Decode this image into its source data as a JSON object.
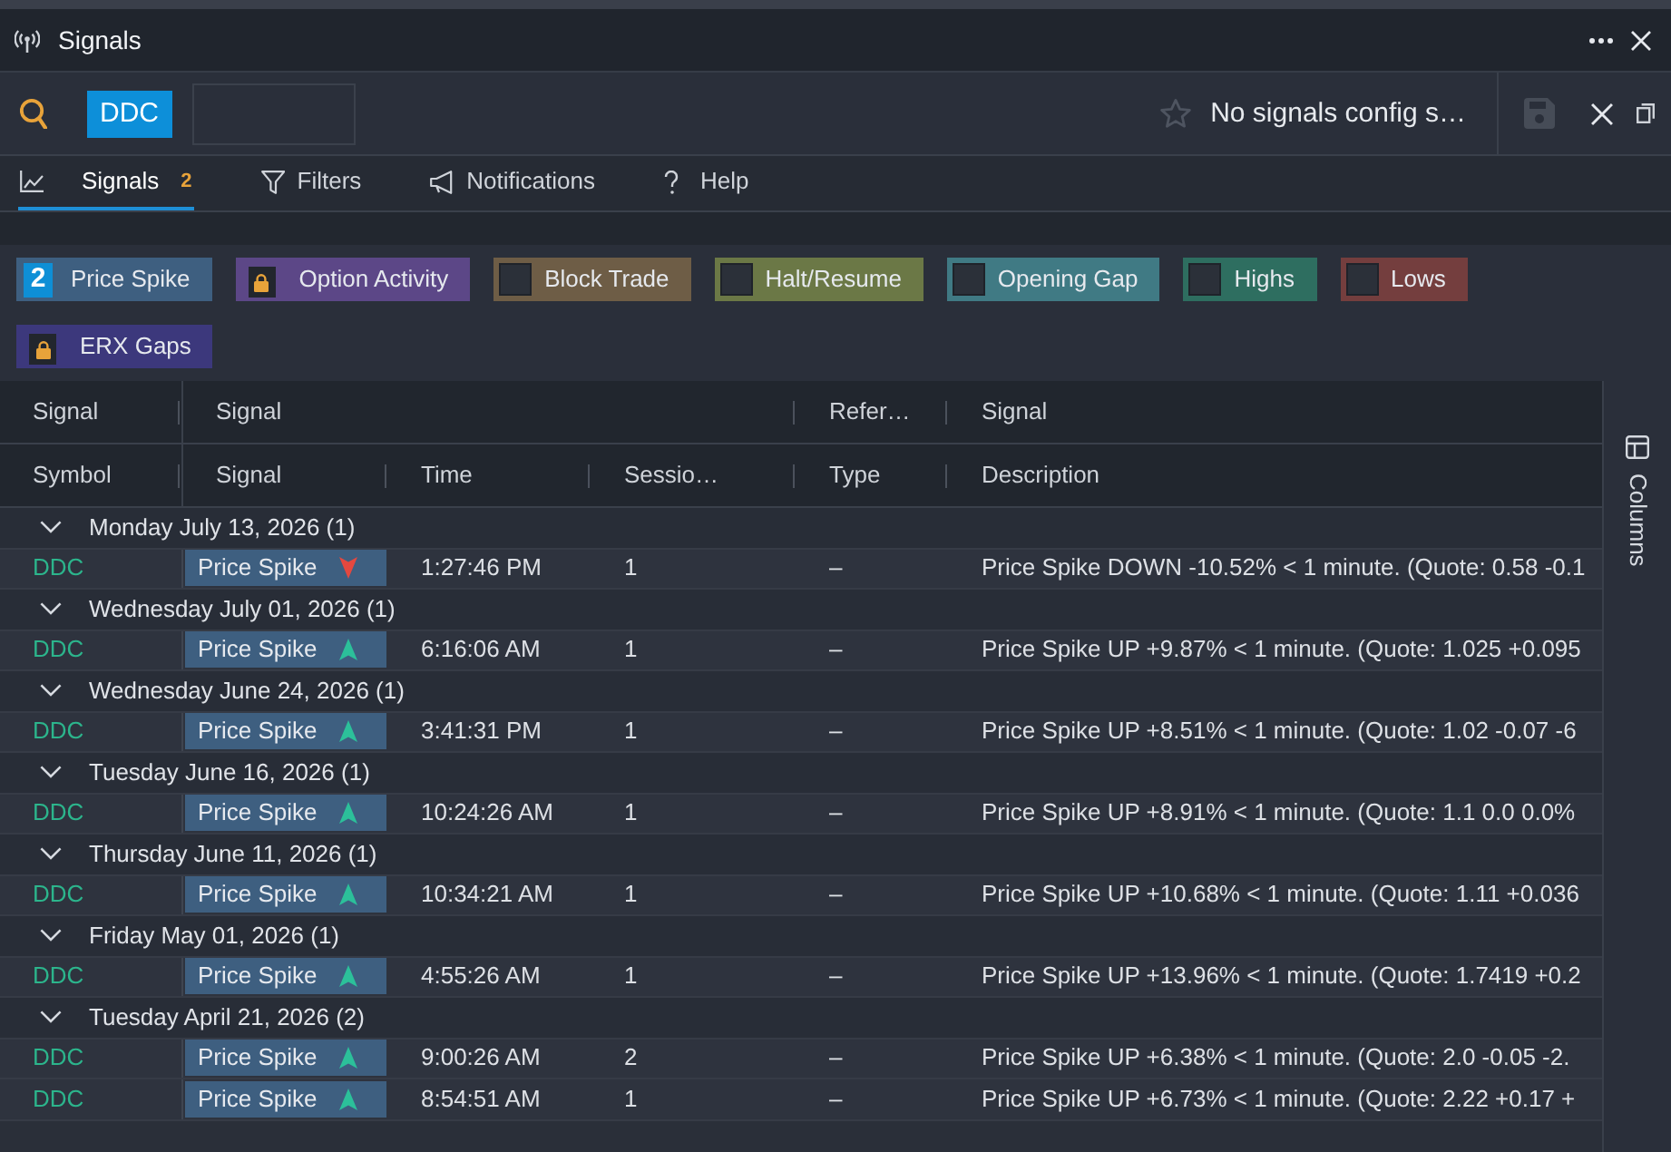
{
  "window": {
    "title": "Signals"
  },
  "toolbar": {
    "symbol": "DDC",
    "starred": false,
    "config_status": "No signals config s…",
    "save_disabled": true
  },
  "tabs": [
    {
      "label": "Signals",
      "badge": "2",
      "selected": true
    },
    {
      "label": "Filters",
      "selected": false
    },
    {
      "label": "Notifications",
      "selected": false
    },
    {
      "label": "Help",
      "selected": false
    }
  ],
  "signal_types": [
    {
      "label": "Price Spike",
      "color": "#3e5f80",
      "locked": false,
      "checked": true,
      "count": "2"
    },
    {
      "label": "Option Activity",
      "color": "#5c4787",
      "locked": true
    },
    {
      "label": "Block Trade",
      "color": "#6e5d46",
      "locked": false,
      "checked": false
    },
    {
      "label": "Halt/Resume",
      "color": "#6b7846",
      "locked": false,
      "checked": false
    },
    {
      "label": "Opening Gap",
      "color": "#407a84",
      "locked": false,
      "checked": false
    },
    {
      "label": "Highs",
      "color": "#2e6e60",
      "locked": false,
      "checked": false
    },
    {
      "label": "Lows",
      "color": "#743e3e",
      "locked": false,
      "checked": false
    },
    {
      "label": "ERX Gaps",
      "color": "#3c387c",
      "locked": true
    }
  ],
  "table": {
    "column_groups": [
      {
        "label": "Signal",
        "columns": [
          "Symbol"
        ]
      },
      {
        "label": "Signal",
        "columns": [
          "Signal",
          "Time",
          "Sessio…"
        ]
      },
      {
        "label": "Refer…",
        "columns": [
          "Type"
        ]
      },
      {
        "label": "Signal",
        "columns": [
          "Description"
        ]
      }
    ],
    "groups": [
      {
        "label": "Monday July 13, 2026 (1)",
        "expanded": true,
        "rows": [
          {
            "symbol": "DDC",
            "signal": "Price Spike",
            "kind": "down",
            "time": "1:27:46 PM",
            "session": "1",
            "type": "–",
            "description": "Price Spike DOWN -10.52% < 1 minute. (Quote: 0.58 -0.1"
          }
        ]
      },
      {
        "label": "Wednesday July 01, 2026 (1)",
        "expanded": true,
        "rows": [
          {
            "symbol": "DDC",
            "signal": "Price Spike",
            "kind": "up",
            "time": "6:16:06 AM",
            "session": "1",
            "type": "–",
            "description": "Price Spike UP +9.87% < 1 minute. (Quote: 1.025 +0.095"
          }
        ]
      },
      {
        "label": "Wednesday June 24, 2026 (1)",
        "expanded": true,
        "rows": [
          {
            "symbol": "DDC",
            "signal": "Price Spike",
            "kind": "up",
            "time": "3:41:31 PM",
            "session": "1",
            "type": "–",
            "description": "Price Spike UP +8.51% < 1 minute. (Quote: 1.02 -0.07 -6"
          }
        ]
      },
      {
        "label": "Tuesday June 16, 2026 (1)",
        "expanded": true,
        "rows": [
          {
            "symbol": "DDC",
            "signal": "Price Spike",
            "kind": "up",
            "time": "10:24:26 AM",
            "session": "1",
            "type": "–",
            "description": "Price Spike UP +8.91% < 1 minute. (Quote: 1.1 0.0 0.0%"
          }
        ]
      },
      {
        "label": "Thursday June 11, 2026 (1)",
        "expanded": true,
        "rows": [
          {
            "symbol": "DDC",
            "signal": "Price Spike",
            "kind": "up",
            "time": "10:34:21 AM",
            "session": "1",
            "type": "–",
            "description": "Price Spike UP +10.68% < 1 minute. (Quote: 1.11 +0.036"
          }
        ]
      },
      {
        "label": "Friday May 01, 2026 (1)",
        "expanded": true,
        "rows": [
          {
            "symbol": "DDC",
            "signal": "Price Spike",
            "kind": "up",
            "time": "4:55:26 AM",
            "session": "1",
            "type": "–",
            "description": "Price Spike UP +13.96% < 1 minute. (Quote: 1.7419 +0.2"
          }
        ]
      },
      {
        "label": "Tuesday April 21, 2026 (2)",
        "expanded": true,
        "rows": [
          {
            "symbol": "DDC",
            "signal": "Price Spike",
            "kind": "up",
            "time": "9:00:26 AM",
            "session": "2",
            "type": "–",
            "description": "Price Spike UP +6.38% < 1 minute. (Quote: 2.0 -0.05 -2."
          },
          {
            "symbol": "DDC",
            "signal": "Price Spike",
            "kind": "up",
            "time": "8:54:51 AM",
            "session": "1",
            "type": "–",
            "description": "Price Spike UP +6.73% < 1 minute. (Quote: 2.22 +0.17 +"
          }
        ]
      }
    ]
  },
  "side_panel": {
    "label": "Columns"
  }
}
